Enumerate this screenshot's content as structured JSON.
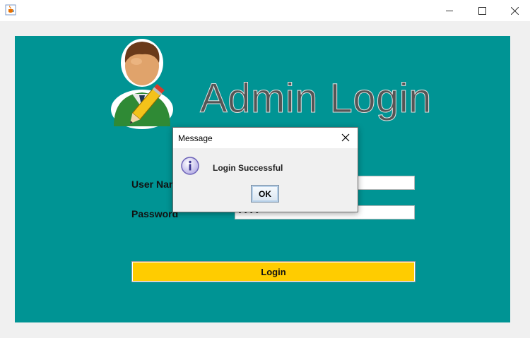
{
  "window": {
    "app_icon": "java-coffee-icon",
    "controls": [
      "minimize-icon",
      "maximize-icon",
      "close-icon"
    ]
  },
  "form": {
    "title": "Admin Login",
    "user_icon": "admin-user-pencil-icon",
    "username_label": "User Name",
    "username_value": "",
    "password_label": "Password",
    "password_value": "••••",
    "login_button": "Login",
    "background_color": "#009494",
    "button_color": "#ffcc00"
  },
  "dialog": {
    "title": "Message",
    "icon": "info-icon",
    "message": "Login Successful",
    "ok_button": "OK"
  }
}
